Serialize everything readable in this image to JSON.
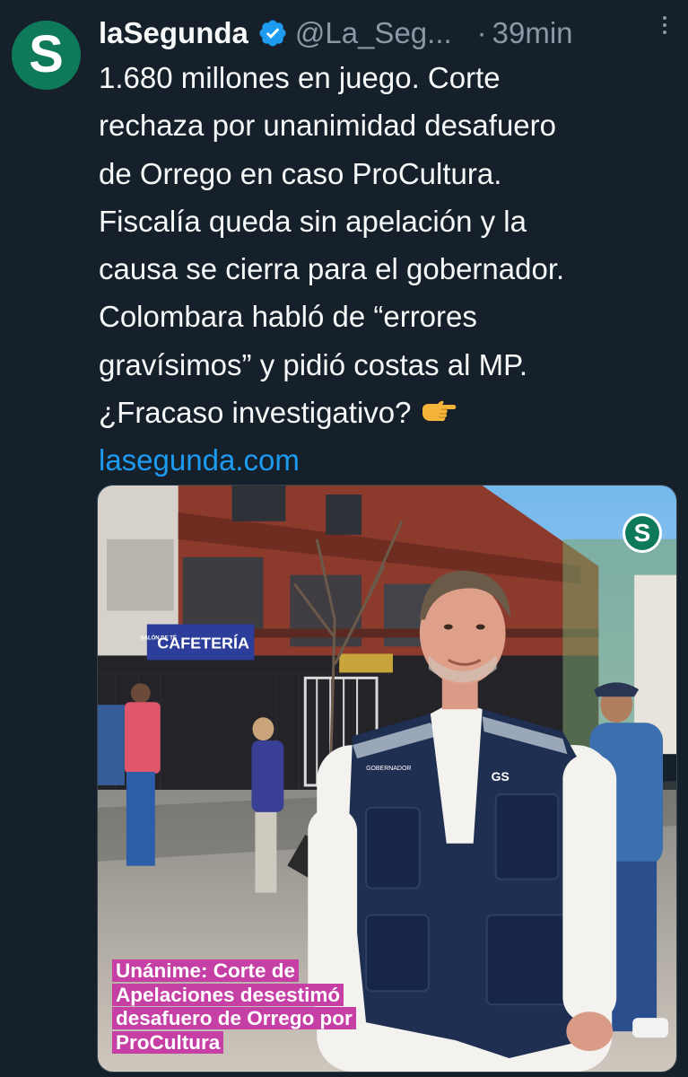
{
  "account": {
    "avatar_letter": "S",
    "display_name": "laSegunda",
    "handle": "@La_Seg...",
    "separator": "·",
    "time": "39min",
    "verified": true
  },
  "tweet": {
    "lines": [
      "1.680 millones en juego. Corte",
      "rechaza por unanimidad desafuero",
      "de Orrego en caso ProCultura.",
      "Fiscalía queda sin apelación y la",
      "causa se cierra para el gobernador.",
      "Colombara habló de “errores",
      "gravísimos” y pidió costas al MP.",
      "¿Fracaso investigativo?"
    ],
    "emoji": "backhand-index-pointing-right",
    "link": "lasegunda.com"
  },
  "media": {
    "watermark_letter": "S",
    "sign_text": "CAFETERÍA",
    "sign_small": "SALÓN DE TÉ",
    "vest_text": "GS",
    "vest_name": "GOBERNADOR",
    "caption_lines": [
      "Unánime: Corte de",
      "Apelaciones desestimó",
      "desafuero de Orrego por",
      "ProCultura"
    ],
    "caption_color": "#c63fa5"
  },
  "colors": {
    "background": "#15202b",
    "text": "#f7f9f9",
    "muted": "#8b98a5",
    "link": "#1d9bf0",
    "brand": "#0f7a5a"
  }
}
